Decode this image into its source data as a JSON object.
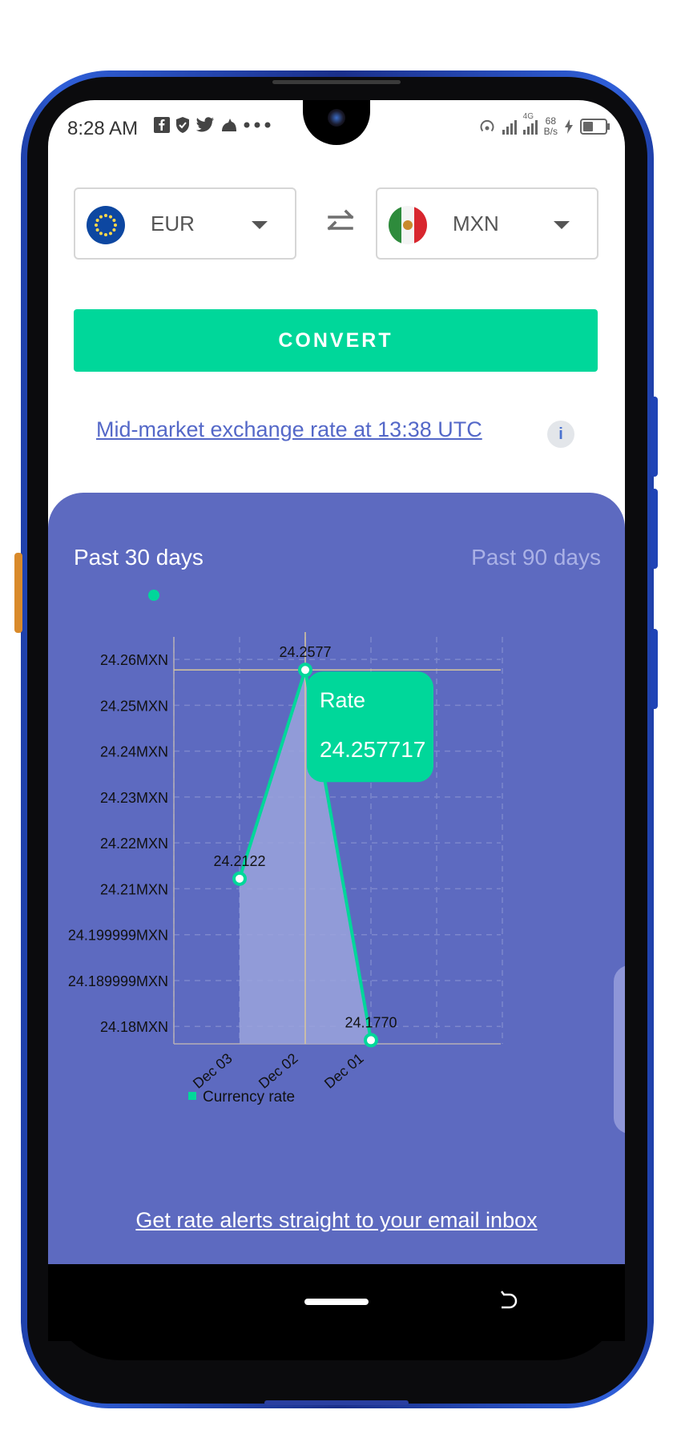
{
  "status_bar": {
    "time": "8:28 AM",
    "left_icons": [
      "facebook-icon",
      "shield-icon",
      "twitter-icon",
      "cat-icon",
      "more-dots-icon"
    ],
    "net_speed_value": "68",
    "net_speed_unit": "B/s",
    "network_type": "4G"
  },
  "converter": {
    "from_currency": "EUR",
    "to_currency": "MXN",
    "from_flag": "eu-flag",
    "to_flag": "mexico-flag",
    "convert_label": "CONVERT",
    "rate_link": "Mid-market exchange rate at 13:38 UTC",
    "info_label": "i"
  },
  "chart_panel": {
    "tab_30": "Past 30 days",
    "tab_90": "Past 90 days",
    "alerts_link": "Get rate alerts straight to your email inbox",
    "tooltip_title": "Rate",
    "tooltip_value": "24.257717"
  },
  "chart_data": {
    "type": "area",
    "title": "",
    "xlabel": "",
    "ylabel": "",
    "x_tick_labels": [
      "Dec 03",
      "Dec 02",
      "Dec 01"
    ],
    "x": [
      "Dec 02",
      "Dec 01 (a)",
      "Dec 01 (b)"
    ],
    "y_tick_labels": [
      "24.26MXN",
      "24.25MXN",
      "24.24MXN",
      "24.23MXN",
      "24.22MXN",
      "24.21MXN",
      "24.199999MXN",
      "24.189999MXN",
      "24.18MXN"
    ],
    "y_ticks": [
      24.26,
      24.25,
      24.24,
      24.23,
      24.22,
      24.21,
      24.2,
      24.19,
      24.18
    ],
    "ylim": [
      24.1762,
      24.2649
    ],
    "points": [
      {
        "x_index": 1,
        "value": 24.2122,
        "label": "24.2122"
      },
      {
        "x_index": 2,
        "value": 24.2577,
        "label": "24.2577"
      },
      {
        "x_index": 3,
        "value": 24.177,
        "label": "24.1770"
      }
    ],
    "series": [
      {
        "name": "Currency rate",
        "values": [
          24.2122,
          24.2577,
          24.177
        ]
      }
    ],
    "legend": "bottom-left",
    "grid": true,
    "colors": {
      "line": "#00d79a",
      "fill": "#9aa3dc",
      "crosshair": "#d9c79a",
      "grid": "#7d87cc"
    }
  },
  "colors": {
    "accent": "#00d79a",
    "panel": "#5d6ac0",
    "link": "#5468c8"
  }
}
